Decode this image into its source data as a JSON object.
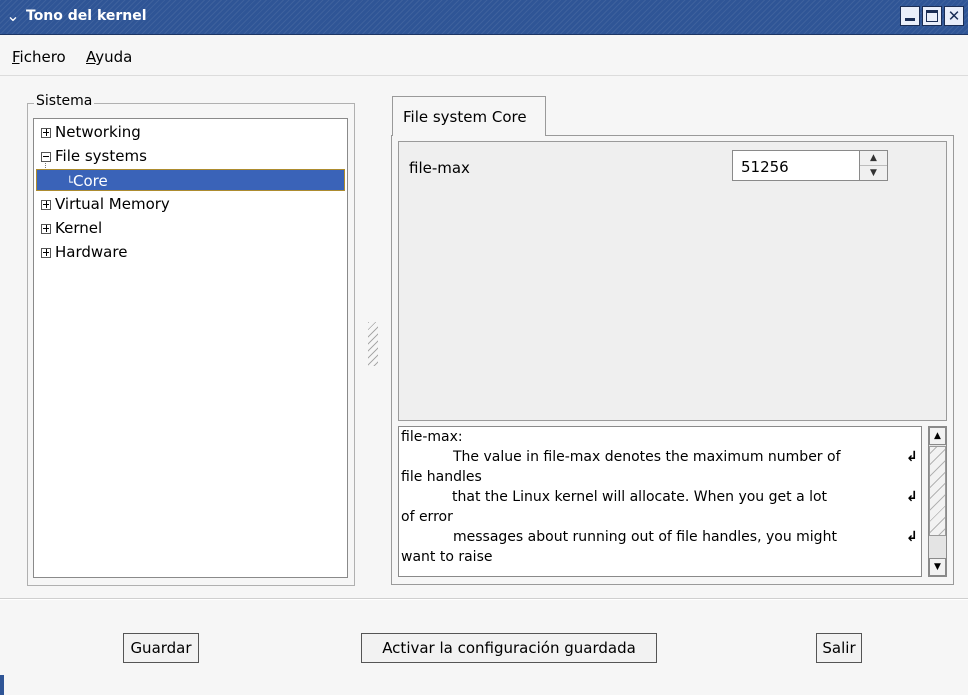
{
  "window": {
    "title": "Tono del kernel"
  },
  "menu": {
    "items": [
      {
        "label": "Fichero",
        "mnemonic": "F"
      },
      {
        "label": "Ayuda",
        "mnemonic": "A"
      }
    ]
  },
  "sidebar": {
    "group_label": "Sistema",
    "tree": [
      {
        "label": "Networking",
        "expander": "plus"
      },
      {
        "label": "File systems",
        "expander": "minus"
      },
      {
        "label": "Core",
        "selected": true
      },
      {
        "label": "Virtual Memory",
        "expander": "plus"
      },
      {
        "label": "Kernel",
        "expander": "plus"
      },
      {
        "label": "Hardware",
        "expander": "plus"
      }
    ]
  },
  "main": {
    "tab_label": "File system Core",
    "parameter": {
      "label": "file-max",
      "value": "51256"
    },
    "description_lines": [
      "file-max:",
      "The value in file-max denotes the maximum number of",
      "file handles",
      "that the Linux kernel will allocate. When you get a lot",
      "of error",
      "messages about running out of file handles, you might",
      "want to raise"
    ]
  },
  "buttons": {
    "save": "Guardar",
    "activate": "Activar la configuración guardada",
    "quit": "Salir"
  },
  "colors": {
    "titlebar": "#2f5596",
    "selection": "#3a63b8"
  }
}
